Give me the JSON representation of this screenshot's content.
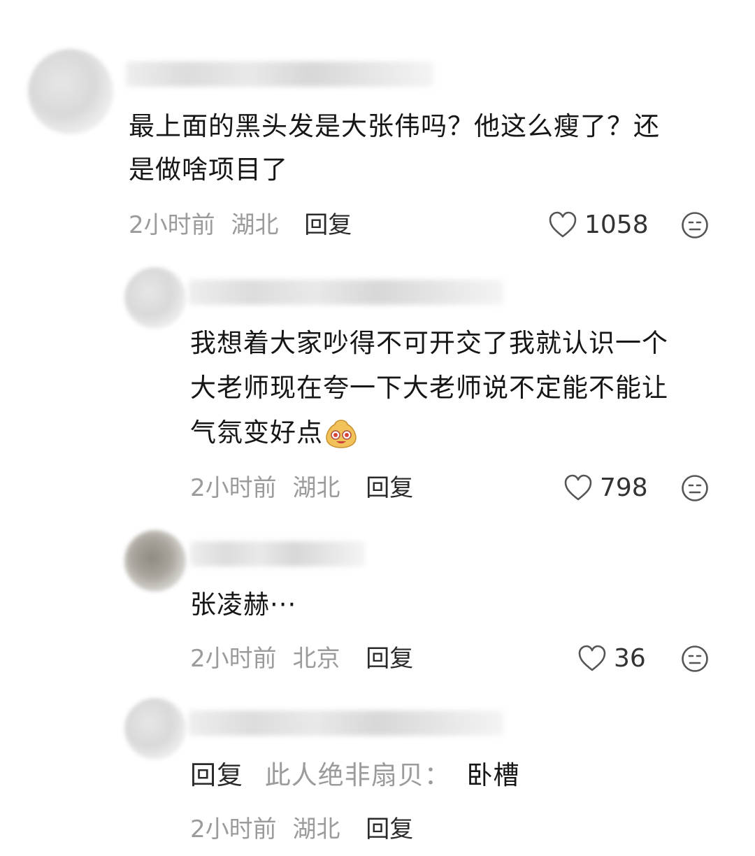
{
  "comments": [
    {
      "text_lines": [
        "最上面的黑头发是大张伟吗？他这么瘦了？还",
        "是做啥项目了"
      ],
      "time": "2小时前",
      "location": "湖北",
      "reply_label": "回复",
      "likes": "1058"
    },
    {
      "text_lines": [
        "我想着大家吵得不可开交了我就认识一个",
        "大老师现在夸一下大老师说不定能不能让",
        "气氛变好点"
      ],
      "time": "2小时前",
      "location": "湖北",
      "reply_label": "回复",
      "likes": "798"
    },
    {
      "text_lines": [
        "张凌赫···"
      ],
      "time": "2小时前",
      "location": "北京",
      "reply_label": "回复",
      "likes": "36"
    },
    {
      "reply_lead": "回复",
      "reply_to": "此人绝非扇贝：",
      "reply_text": "卧槽",
      "time": "2小时前",
      "location": "湖北",
      "reply_label": "回复"
    }
  ],
  "colors": {
    "meta": "#9b9b9b",
    "text": "#161616",
    "icon": "#555555"
  }
}
